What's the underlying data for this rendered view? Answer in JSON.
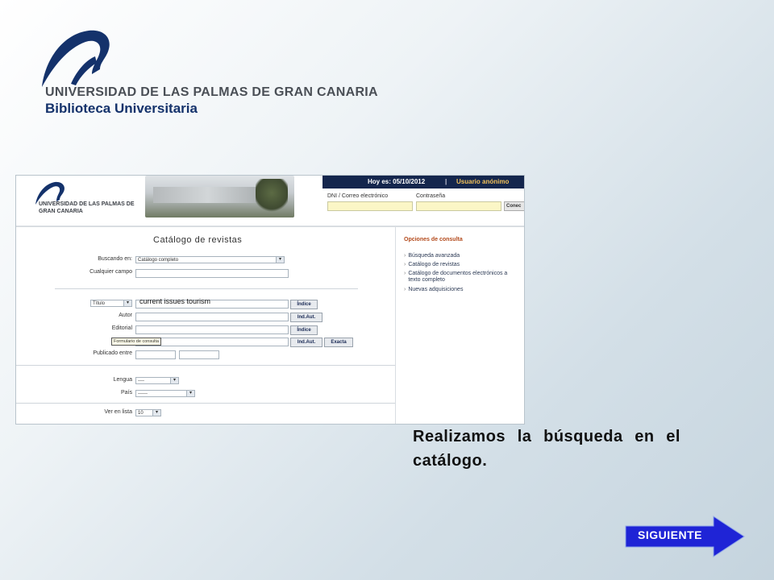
{
  "slide": {
    "university": "UNIVERSIDAD DE LAS PALMAS DE GRAN CANARIA",
    "library": "Biblioteca Universitaria",
    "caption": "Realizamos la búsqueda en el catálogo.",
    "next_label": "SIGUIENTE"
  },
  "colors": {
    "brand_navy": "#14264d",
    "next_button": "#1f24d6",
    "accent_orange": "#b34a1c"
  },
  "screenshot": {
    "header": {
      "logo_text": "UNIVERSIDAD DE LAS PALMAS DE GRAN CANARIA",
      "today": "Hoy es: 05/10/2012",
      "separator": "|",
      "user": "Usuario anónimo"
    },
    "login": {
      "dni_label": "DNI / Correo electrónico",
      "password_label": "Contraseña",
      "connect_label": "Conec"
    },
    "form": {
      "title": "Catálogo de revistas",
      "buscando_label": "Buscando en:",
      "buscando_value": "Catálogo completo",
      "cualquier_label": "Cualquier campo",
      "title_field_select": "Título",
      "title_field_value": "current  issues tourism",
      "indice_label": "Índice",
      "autor_label": "Autor",
      "indaut_label": "Ind.Aut.",
      "editorial_label": "Editorial",
      "indice2_label": "Índice",
      "tooltip": "Formulario de consulta",
      "indaut2_label": "Ind.Aut.",
      "exacta_label": "Exacta",
      "publicado_label": "Publicado entre",
      "lengua_label": "Lengua",
      "lengua_value": "----",
      "pais_label": "País",
      "pais_value": "------",
      "verenlista_label": "Ver en lista",
      "verenlista_value": "10"
    },
    "options": {
      "title": "Opciones de consulta",
      "items": [
        "Búsqueda avanzada",
        "Catálogo de revistas",
        "Catálogo de documentos electrónicos a texto completo",
        "Nuevas adquisiciones"
      ]
    }
  }
}
